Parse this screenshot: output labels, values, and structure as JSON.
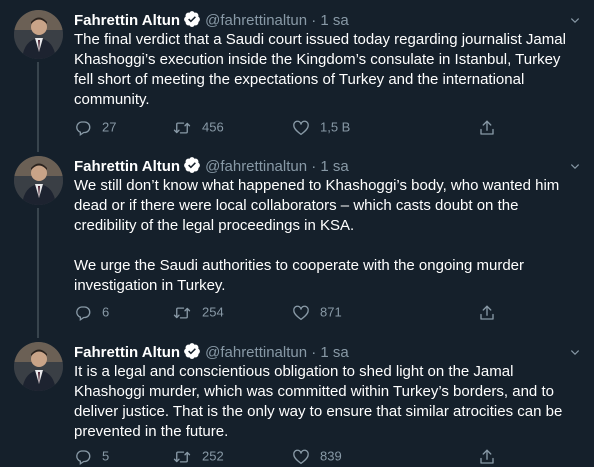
{
  "author": {
    "name": "Fahrettin Altun",
    "handle": "@fahrettinaltun",
    "separator": "·"
  },
  "colors": {
    "background": "#15202b",
    "text": "#ffffff",
    "secondary_text": "#8899a6",
    "verified_badge": "#ffffff",
    "thread_line": "#38444d"
  },
  "tweets": [
    {
      "time": "1 sa",
      "paragraphs": [
        "The final verdict that a Saudi court issued today regarding journalist Jamal Khashoggi’s execution inside the Kingdom’s consulate in Istanbul, Turkey fell short of meeting the expectations of Turkey and the international community."
      ],
      "replies": "27",
      "retweets": "456",
      "likes": "1,5 B"
    },
    {
      "time": "1 sa",
      "paragraphs": [
        "We still don’t know what happened to Khashoggi’s body, who wanted him dead or if there were local collaborators – which casts doubt on the credibility of the legal proceedings in KSA.",
        "We urge the Saudi authorities to cooperate with the ongoing murder investigation in Turkey."
      ],
      "replies": "6",
      "retweets": "254",
      "likes": "871"
    },
    {
      "time": "1 sa",
      "paragraphs": [
        "It is a legal and conscientious obligation to shed light on the Jamal Khashoggi murder, which was committed within Turkey’s borders, and to deliver justice. That is the only way to ensure that similar atrocities can be prevented in the future."
      ],
      "replies": "5",
      "retweets": "252",
      "likes": "839"
    }
  ]
}
